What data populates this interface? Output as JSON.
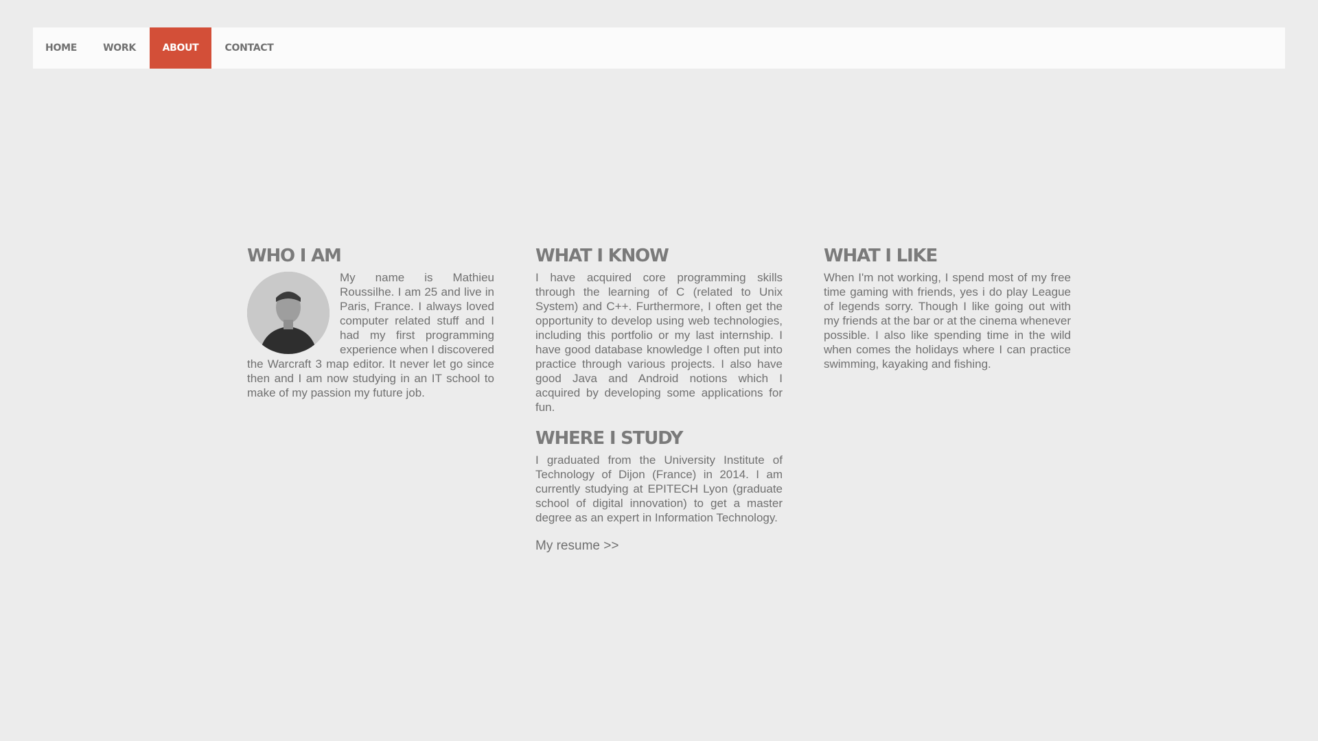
{
  "nav": {
    "items": [
      {
        "label": "HOME"
      },
      {
        "label": "WORK"
      },
      {
        "label": "ABOUT"
      },
      {
        "label": "CONTACT"
      }
    ],
    "active_color": "#d34f38"
  },
  "who": {
    "title": "WHO I AM",
    "text": "My name is Mathieu Roussilhe. I am 25 and live in Paris, France. I always loved computer related stuff and I had my first programming experience when I discovered the Warcraft 3 map editor. It never let go since then and I am now studying in an IT school to make of my passion my future job."
  },
  "know": {
    "title": "WHAT I KNOW",
    "text": "I have acquired core programming skills through the learning of C (related to Unix System) and C++. Furthermore, I often get the opportunity to develop using web technologies, including this portfolio or my last internship. I have good database knowledge I often put into practice through various projects. I also have good Java and Android notions which I acquired by developing some applications for fun."
  },
  "study": {
    "title": "WHERE I STUDY",
    "text": "I graduated from the University Institute of Technology of Dijon (France) in 2014. I am currently studying at EPITECH Lyon (graduate school of digital innovation) to get a master degree as an expert in Information Technology.",
    "resume_link": "My resume >>"
  },
  "like": {
    "title": "WHAT I LIKE",
    "text": "When I'm not working, I spend most of my free time gaming with friends, yes i do play League of legends sorry. Though I like going out with my friends at the bar or at the cinema whenever possible. I also like spending time in the wild when comes the holidays where I can practice swimming, kayaking and fishing."
  }
}
